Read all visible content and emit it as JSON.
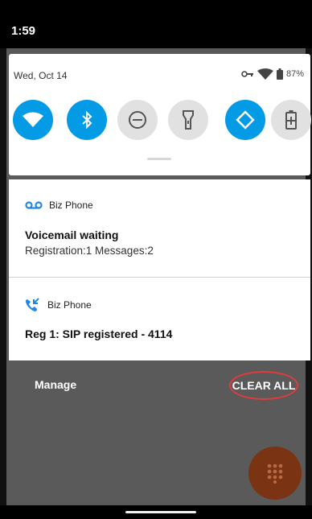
{
  "status_bar": {
    "time": "1:59"
  },
  "quick_settings": {
    "date": "Wed, Oct 14",
    "battery": "87%",
    "tiles": [
      {
        "name": "wifi",
        "state": "on"
      },
      {
        "name": "bluetooth",
        "state": "on"
      },
      {
        "name": "do-not-disturb",
        "state": "off"
      },
      {
        "name": "flashlight",
        "state": "off"
      },
      {
        "name": "auto-rotate",
        "state": "on"
      },
      {
        "name": "battery-saver",
        "state": "off"
      }
    ],
    "colors": {
      "on": "#039be5",
      "off": "#e1e1e1"
    }
  },
  "notifications": [
    {
      "app": "Biz Phone",
      "icon": "voicemail-icon",
      "title": "Voicemail waiting",
      "text": "Registration:1 Messages:2"
    },
    {
      "app": "Biz Phone",
      "icon": "phone-callback-icon",
      "title": "",
      "text": "Reg 1: SIP registered - 4114"
    }
  ],
  "actions": {
    "manage": "Manage",
    "clear_all": "CLEAR ALL"
  },
  "colors": {
    "accent": "#039be5",
    "highlight_circle": "#e23b3b",
    "fab": "#7a3413"
  }
}
